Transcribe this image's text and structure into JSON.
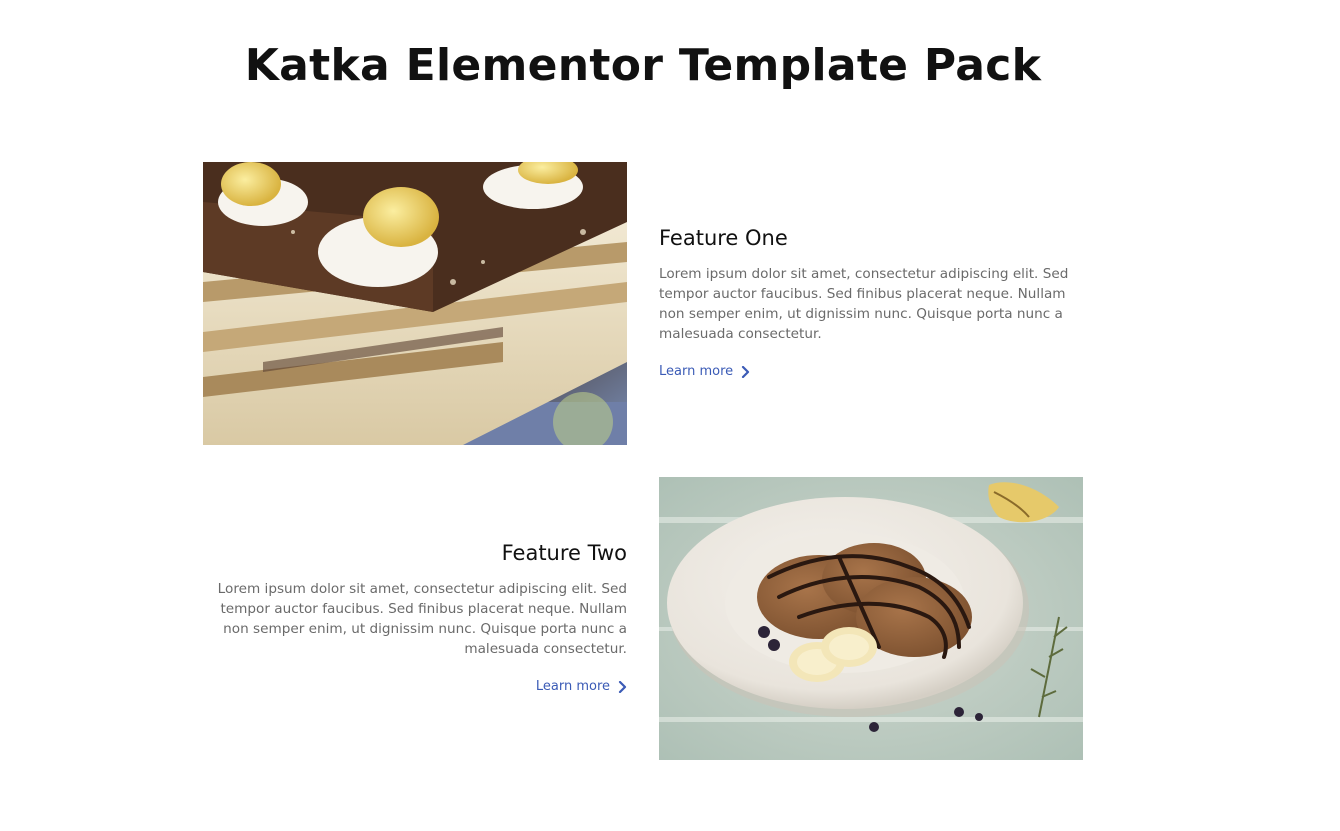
{
  "page": {
    "title": "Katka Elementor Template Pack"
  },
  "features": [
    {
      "heading": "Feature One",
      "body": "Lorem ipsum dolor sit amet, consectetur adipiscing elit. Sed tempor auctor faucibus. Sed finibus placerat neque. Nullam non semper enim, ut dignissim nunc. Quisque porta nunc a malesuada consectetur.",
      "link_label": "Learn more",
      "image": "layered-cake-photo"
    },
    {
      "heading": "Feature Two",
      "body": "Lorem ipsum dolor sit amet, consectetur adipiscing elit. Sed tempor auctor faucibus. Sed finibus placerat neque. Nullam non semper enim, ut dignissim nunc. Quisque porta nunc a malesuada consectetur.",
      "link_label": "Learn more",
      "image": "pancakes-plate-photo"
    }
  ],
  "colors": {
    "heading": "#111111",
    "body_text": "#6a6a6a",
    "link": "#3b5bb6"
  }
}
